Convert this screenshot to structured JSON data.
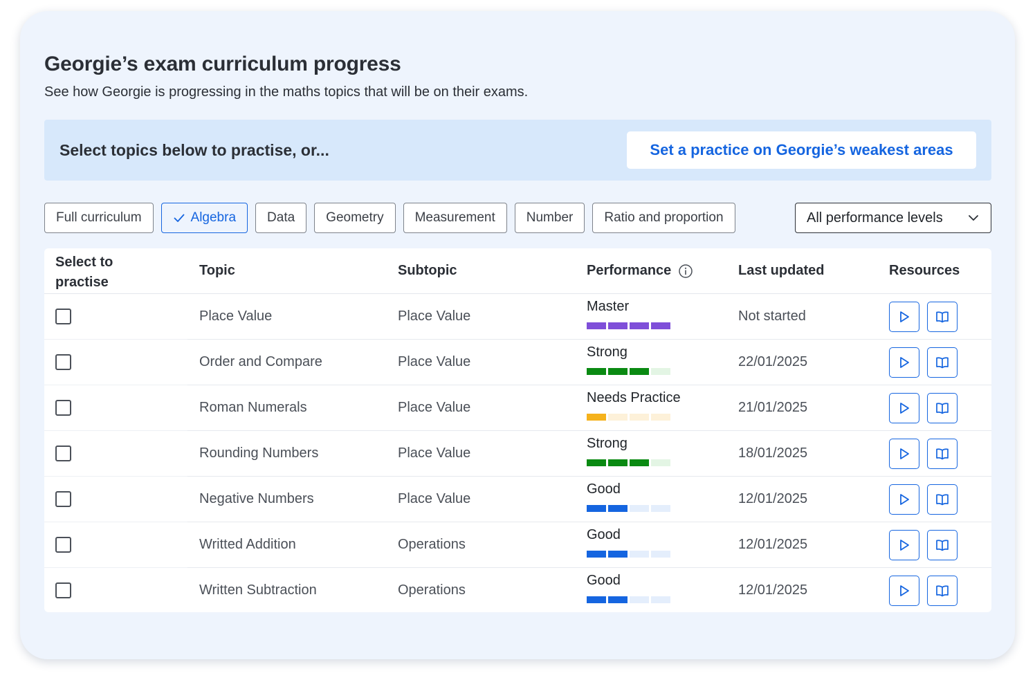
{
  "header": {
    "title": "Georgie’s exam curriculum progress",
    "subtitle": "See how Georgie is progressing in the maths topics that will be on their exams."
  },
  "banner": {
    "text": "Select topics below to practise, or...",
    "button_label": "Set a practice on Georgie’s weakest areas"
  },
  "filters": {
    "chips": [
      {
        "label": "Full curriculum",
        "active": false
      },
      {
        "label": "Algebra",
        "active": true
      },
      {
        "label": "Data",
        "active": false
      },
      {
        "label": "Geometry",
        "active": false
      },
      {
        "label": "Measurement",
        "active": false
      },
      {
        "label": "Number",
        "active": false
      },
      {
        "label": "Ratio and proportion",
        "active": false
      }
    ],
    "performance_select": {
      "value": "All performance levels",
      "icon": "chevron-down-icon"
    }
  },
  "table": {
    "headers": {
      "select": "Select to practise",
      "topic": "Topic",
      "subtopic": "Subtopic",
      "performance": "Performance",
      "last_updated": "Last updated",
      "resources": "Resources"
    },
    "rows": [
      {
        "topic": "Place Value",
        "subtopic": "Place Value",
        "performance": "Master",
        "level": 4,
        "last_updated": "Not started",
        "checked": false
      },
      {
        "topic": "Order and Compare",
        "subtopic": "Place Value",
        "performance": "Strong",
        "level": 3,
        "last_updated": "22/01/2025",
        "checked": false
      },
      {
        "topic": "Roman Numerals",
        "subtopic": "Place Value",
        "performance": "Needs Practice",
        "level": 1,
        "last_updated": "21/01/2025",
        "checked": false
      },
      {
        "topic": "Rounding Numbers",
        "subtopic": "Place Value",
        "performance": "Strong",
        "level": 3,
        "last_updated": "18/01/2025",
        "checked": false
      },
      {
        "topic": "Negative Numbers",
        "subtopic": "Place Value",
        "performance": "Good",
        "level": 2,
        "last_updated": "12/01/2025",
        "checked": false
      },
      {
        "topic": "Writted Addition",
        "subtopic": "Operations",
        "performance": "Good",
        "level": 2,
        "last_updated": "12/01/2025",
        "checked": false
      },
      {
        "topic": "Written Subtraction",
        "subtopic": "Operations",
        "performance": "Good",
        "level": 2,
        "last_updated": "12/01/2025",
        "checked": false
      }
    ]
  },
  "performance_colors": {
    "Master": {
      "filled": "#7f4fd9",
      "empty": "#ece4fb"
    },
    "Strong": {
      "filled": "#0a8a12",
      "empty": "#e3f5e4"
    },
    "Needs Practice": {
      "filled": "#f5b21c",
      "empty": "#fdf1d9"
    },
    "Good": {
      "filled": "#1565e0",
      "empty": "#e4eefc"
    }
  },
  "resource_icons": [
    "play-icon",
    "book-icon"
  ],
  "colors": {
    "accent": "#1565e0",
    "card_bg": "#eef4fd",
    "banner_bg": "#d7e8fb"
  }
}
